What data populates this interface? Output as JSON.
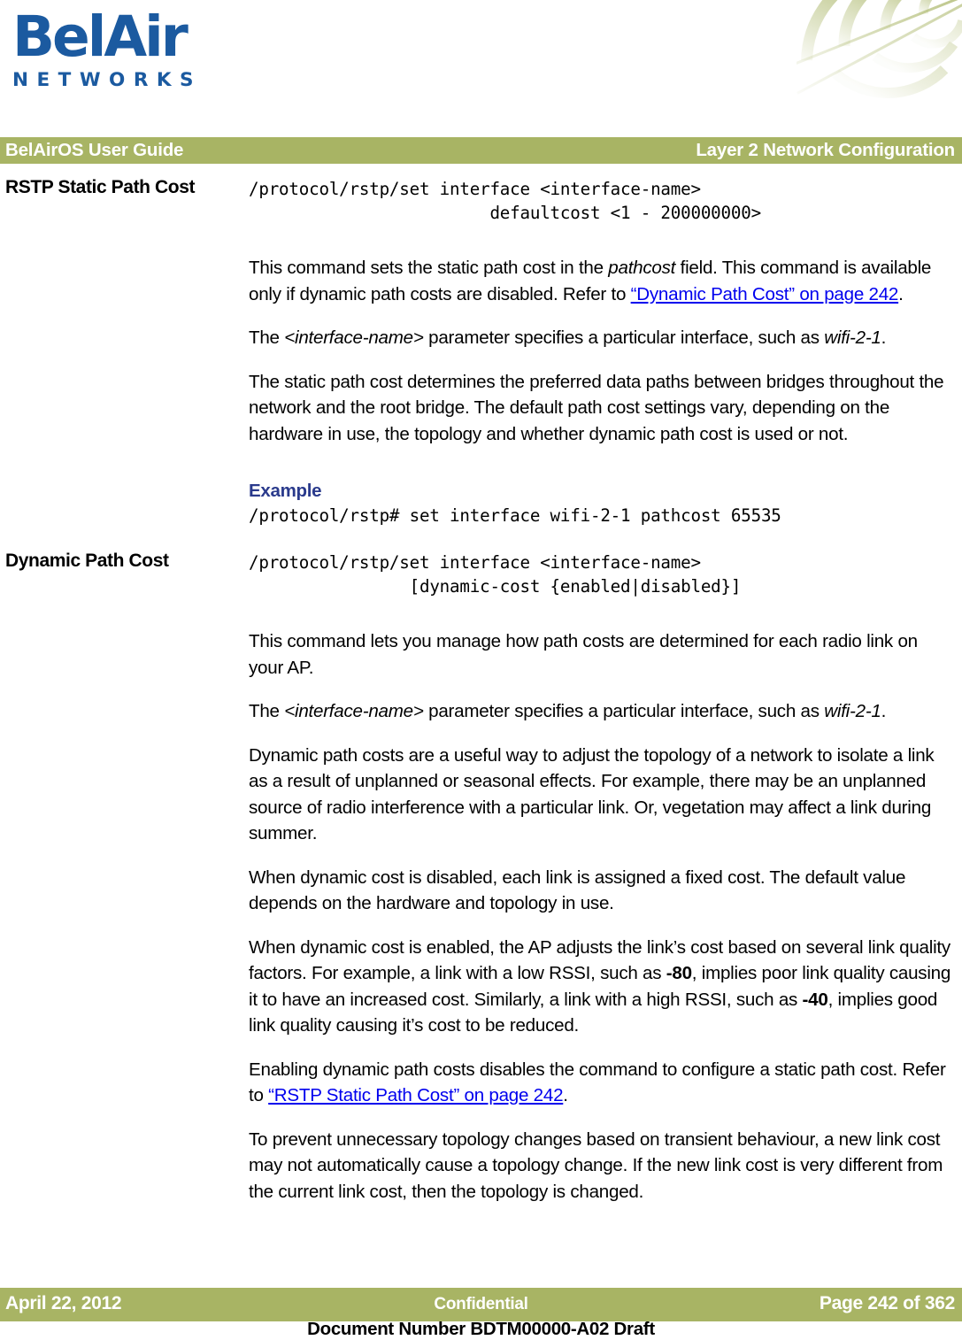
{
  "brand": {
    "logo_word": "BelAir",
    "logo_sub": "NETWORKS",
    "logo_color": "#1B5AA0",
    "corner_art_color": "#A8B464"
  },
  "header": {
    "left": "BelAirOS User Guide",
    "right": "Layer 2 Network Configuration",
    "bar_color": "#A8B464"
  },
  "sections": [
    {
      "heading": "RSTP Static Path Cost",
      "code": "/protocol/rstp/set interface <interface-name>\n                        defaultcost <1 - 200000000>",
      "paragraphs": [
        {
          "p1_a": "This command sets the static path cost in the ",
          "p1_italic": "pathcost",
          "p1_b": " field. This command is available only if dynamic path costs are disabled. Refer to ",
          "p1_link": "“Dynamic Path Cost” on page 242",
          "p1_c": "."
        },
        {
          "p2_a": "The  ",
          "p2_italic": "<interface-name>",
          "p2_b": " parameter specifies a particular interface, such as ",
          "p2_italic2": "wifi-2-1",
          "p2_c": "."
        },
        {
          "p3": "The static path cost determines the preferred data paths between bridges throughout the network and the root bridge. The default path cost settings vary, depending on the hardware in use, the topology and whether dynamic path cost is used or not."
        }
      ],
      "example_label": "Example",
      "example_code": "/protocol/rstp# set interface wifi-2-1 pathcost 65535"
    },
    {
      "heading": "Dynamic Path Cost",
      "code": "/protocol/rstp/set interface <interface-name>\n                [dynamic-cost {enabled|disabled}]",
      "paragraphs": [
        {
          "p1": "This command lets you manage how path costs are determined for each radio link on your AP."
        },
        {
          "p2_a": "The  ",
          "p2_italic": "<interface-name>",
          "p2_b": " parameter specifies a particular interface, such as ",
          "p2_italic2": "wifi-2-1",
          "p2_c": "."
        },
        {
          "p3": "Dynamic path costs are a useful way to adjust the topology of a network to isolate a link as a result of unplanned or seasonal effects. For example, there may be an unplanned source of radio interference with a particular link. Or, vegetation may affect a link during summer."
        },
        {
          "p4": "When dynamic cost is disabled, each link is assigned a fixed cost. The default value depends on the hardware and topology in use."
        },
        {
          "p5_a": "When dynamic cost is enabled, the AP adjusts the link’s cost based on several link quality factors. For example, a link with a low RSSI, such as ",
          "p5_bold1": "-80",
          "p5_b": ", implies poor link quality causing it to have an increased cost. Similarly, a link with a high RSSI, such as ",
          "p5_bold2": "-40",
          "p5_c": ", implies good link quality causing it’s cost to be reduced."
        },
        {
          "p6_a": "Enabling dynamic path costs disables the command to configure a static path cost. Refer to ",
          "p6_link": "“RSTP Static Path Cost” on page 242",
          "p6_b": "."
        },
        {
          "p7": "To prevent unnecessary topology changes based on transient behaviour, a new link cost may not automatically cause a topology change. If the new link cost is very different from the current link cost, then the topology is changed."
        }
      ]
    }
  ],
  "footer": {
    "date": "April 22, 2012",
    "classification": "Confidential",
    "page": "Page 242 of 362",
    "document_number": "Document Number BDTM00000-A02 Draft",
    "bar_color": "#A8B464"
  },
  "links": {
    "color": "#0000EE"
  },
  "example_heading_color": "#2A3A8C"
}
